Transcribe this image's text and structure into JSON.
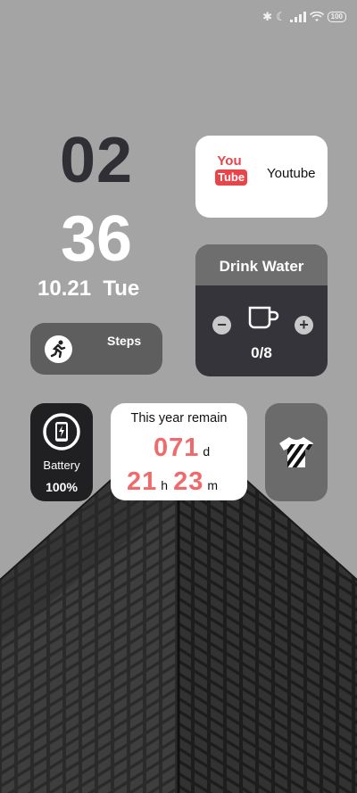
{
  "status_bar": {
    "icons": [
      "bluetooth-icon",
      "moon-icon",
      "signal-icon",
      "wifi-icon",
      "battery-icon"
    ],
    "battery_level": "100"
  },
  "clock": {
    "hour": "02",
    "minute": "36",
    "date": "10.21  Tue"
  },
  "youtube_widget": {
    "logo_you": "You",
    "logo_tube": "Tube",
    "label": "Youtube"
  },
  "water_widget": {
    "title": "Drink Water",
    "minus": "−",
    "plus": "+",
    "count": "0/8",
    "icon": "cup-icon"
  },
  "steps_widget": {
    "label": "Steps",
    "icon": "running-icon"
  },
  "battery_widget": {
    "label": "Battery",
    "value": "100%",
    "icon": "phone-charging-icon"
  },
  "remain_widget": {
    "title": "This year remain",
    "days": "071",
    "days_unit": "d",
    "hours": "21",
    "hours_unit": "h",
    "minutes": "23",
    "minutes_unit": "m"
  },
  "shirt_widget": {
    "icon": "shirt-icon"
  },
  "colors": {
    "accent_red": "#f0696b",
    "dark_card": "#34343a",
    "background": "#a4a4a4"
  }
}
